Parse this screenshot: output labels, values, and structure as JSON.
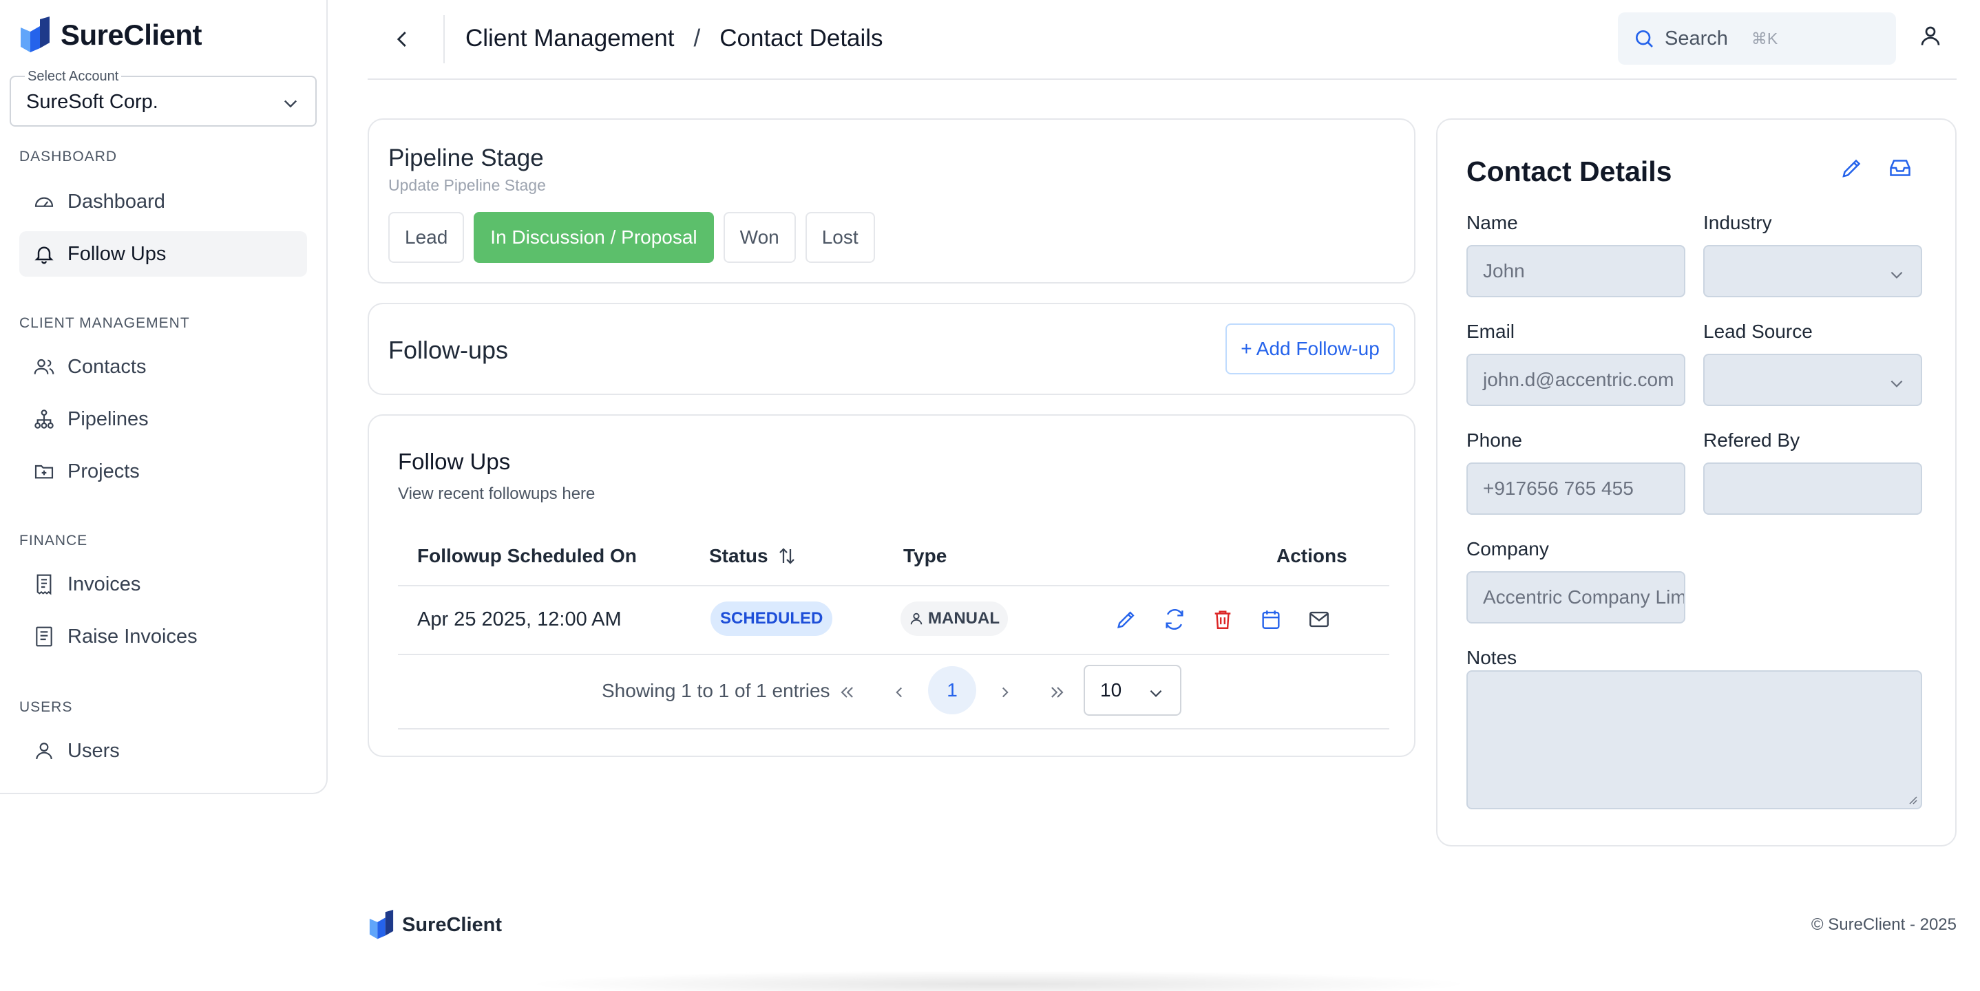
{
  "app": {
    "brand": "SureClient"
  },
  "sidebar": {
    "account_legend": "Select Account",
    "account_value": "SureSoft Corp.",
    "sections": {
      "dashboard": "DASHBOARD",
      "client_management": "CLIENT MANAGEMENT",
      "finance": "FINANCE",
      "users": "USERS"
    },
    "items": {
      "dashboard": "Dashboard",
      "follow_ups": "Follow Ups",
      "contacts": "Contacts",
      "pipelines": "Pipelines",
      "projects": "Projects",
      "invoices": "Invoices",
      "raise_invoices": "Raise Invoices",
      "users": "Users"
    },
    "active_item": "Follow Ups"
  },
  "header": {
    "breadcrumb_parent": "Client Management",
    "breadcrumb_sep": "/",
    "breadcrumb_current": "Contact Details",
    "search_label": "Search",
    "search_shortcut": "⌘K"
  },
  "pipeline": {
    "title": "Pipeline Stage",
    "subtitle": "Update Pipeline Stage",
    "stages": [
      "Lead",
      "In Discussion / Proposal",
      "Won",
      "Lost"
    ],
    "active_stage": "In Discussion / Proposal"
  },
  "followups_card": {
    "title": "Follow-ups",
    "add_button": "+ Add Follow-up"
  },
  "followups_table": {
    "title": "Follow Ups",
    "description": "View recent followups here",
    "columns": {
      "date": "Followup Scheduled On",
      "status": "Status",
      "type": "Type",
      "actions": "Actions"
    },
    "rows": [
      {
        "date": "Apr 25 2025, 12:00 AM",
        "status": "SCHEDULED",
        "type": "MANUAL"
      }
    ],
    "pagination": {
      "summary": "Showing 1 to 1 of 1 entries",
      "current_page": "1",
      "page_size": "10"
    }
  },
  "contact": {
    "title": "Contact Details",
    "fields": {
      "name_label": "Name",
      "name_value": "John",
      "industry_label": "Industry",
      "industry_value": "",
      "email_label": "Email",
      "email_value": "john.d@accentric.com",
      "lead_source_label": "Lead Source",
      "lead_source_value": "",
      "phone_label": "Phone",
      "phone_value": "+917656 765 455",
      "referred_by_label": "Refered By",
      "referred_by_value": "",
      "company_label": "Company",
      "company_value": "Accentric Company Limited",
      "notes_label": "Notes",
      "notes_value": ""
    }
  },
  "footer": {
    "brand": "SureClient",
    "copyright": "© SureClient - 2025"
  },
  "colors": {
    "accent_blue": "#2563eb",
    "stage_active_green": "#5cbf6b",
    "danger_red": "#dc2626",
    "badge_blue_bg": "#dbeafe",
    "input_bg": "#e2e8f0"
  }
}
